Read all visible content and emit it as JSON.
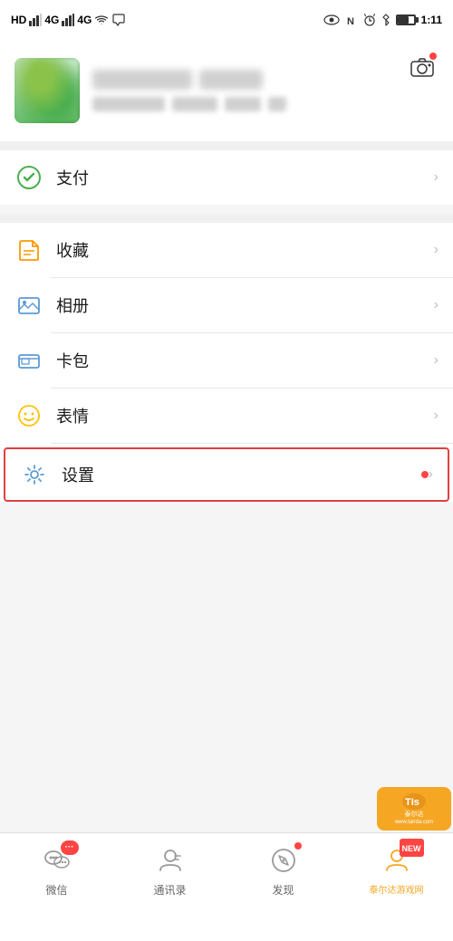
{
  "statusBar": {
    "carrier": "HD",
    "signal4g": "46",
    "signal4g2": "46",
    "time": "1:11",
    "wifiIcon": "wifi",
    "bluetoothIcon": "bluetooth",
    "nfcIcon": "nfc",
    "alarmIcon": "alarm",
    "batteryIcon": "battery"
  },
  "profile": {
    "cameraLabel": "相机",
    "avatarAlt": "用户头像"
  },
  "menuSections": [
    {
      "id": "payment-section",
      "items": [
        {
          "id": "payment",
          "icon": "payment-icon",
          "label": "支付",
          "hasChevron": true,
          "hasDot": false,
          "hasRedBorder": false
        }
      ]
    },
    {
      "id": "favorites-section",
      "items": [
        {
          "id": "favorites",
          "icon": "favorites-icon",
          "label": "收藏",
          "hasChevron": true,
          "hasDot": false,
          "hasRedBorder": false
        },
        {
          "id": "album",
          "icon": "album-icon",
          "label": "相册",
          "hasChevron": true,
          "hasDot": false,
          "hasRedBorder": false
        },
        {
          "id": "card",
          "icon": "card-icon",
          "label": "卡包",
          "hasChevron": true,
          "hasDot": false,
          "hasRedBorder": false
        },
        {
          "id": "emoji",
          "icon": "emoji-icon",
          "label": "表情",
          "hasChevron": true,
          "hasDot": false,
          "hasRedBorder": false
        },
        {
          "id": "settings",
          "icon": "settings-icon",
          "label": "设置",
          "hasChevron": true,
          "hasDot": true,
          "hasRedBorder": true
        }
      ]
    }
  ],
  "bottomNav": {
    "items": [
      {
        "id": "wechat",
        "label": "微信",
        "icon": "chat-icon",
        "hasBadge": true,
        "badgeType": "text",
        "badgeText": "···",
        "isActive": false
      },
      {
        "id": "contacts",
        "label": "通讯录",
        "icon": "contacts-icon",
        "hasBadge": false,
        "isActive": false
      },
      {
        "id": "discover",
        "label": "发现",
        "icon": "discover-icon",
        "hasBadge": true,
        "badgeType": "dot",
        "isActive": false
      },
      {
        "id": "me",
        "label": "泰尔达游戏网",
        "icon": "me-icon",
        "hasBadge": true,
        "badgeType": "new",
        "badgeText": "NEW",
        "isActive": true
      }
    ]
  },
  "watermark": {
    "line1": "泰尔达",
    "line2": "www.tairda.com"
  }
}
